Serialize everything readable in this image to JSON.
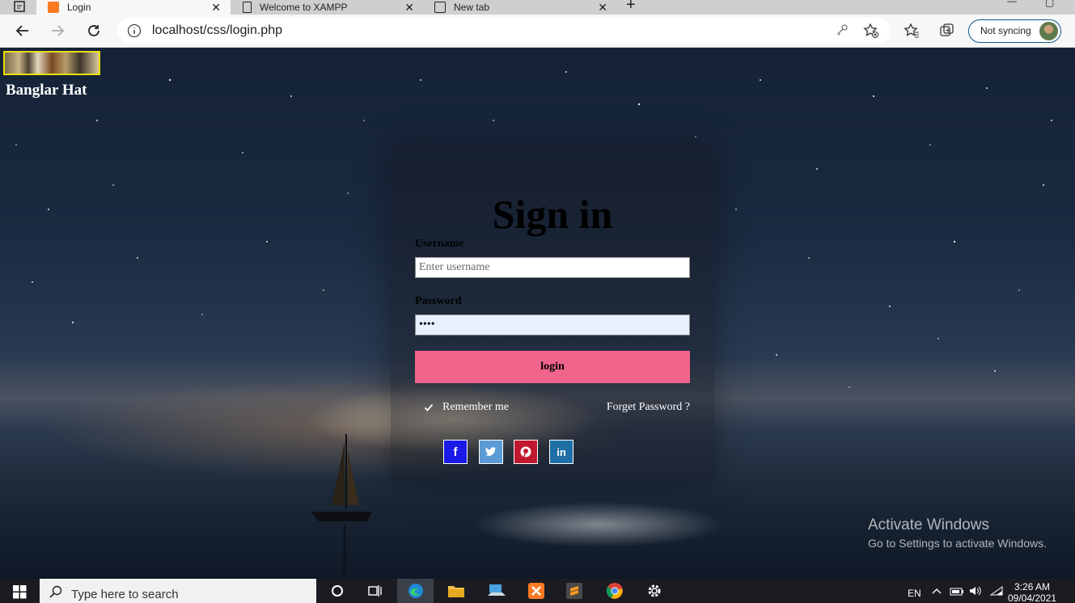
{
  "browser": {
    "tabs": [
      {
        "title": "Login",
        "icon": "xampp-favicon-icon",
        "active": true
      },
      {
        "title": "Welcome to XAMPP",
        "icon": "page-icon",
        "active": false
      },
      {
        "title": "New tab",
        "icon": "new-tab-icon",
        "active": false
      }
    ],
    "url": "localhost/css/login.php",
    "sync_label": "Not syncing"
  },
  "page": {
    "brand": "Banglar Hat",
    "form": {
      "title": "Sign in",
      "username_label": "Username",
      "username_placeholder": "Enter username",
      "username_value": "",
      "password_label": "Password",
      "password_value": "****",
      "login_label": "login",
      "remember_label": "Remember me",
      "remember_checked": true,
      "forgot_label": "Forget Password ?"
    },
    "social": [
      {
        "name": "facebook",
        "glyph": "f",
        "color": "#1a1ae6"
      },
      {
        "name": "twitter",
        "glyph": "t",
        "color": "#5b9bd5"
      },
      {
        "name": "pinterest",
        "glyph": "p",
        "color": "#c0182e"
      },
      {
        "name": "linkedin",
        "glyph": "in",
        "color": "#1d6fa5"
      }
    ],
    "watermark": {
      "line1": "Activate Windows",
      "line2": "Go to Settings to activate Windows."
    }
  },
  "taskbar": {
    "search_placeholder": "Type here to search",
    "language": "EN",
    "time": "3:26 AM",
    "date": "09/04/2021"
  }
}
